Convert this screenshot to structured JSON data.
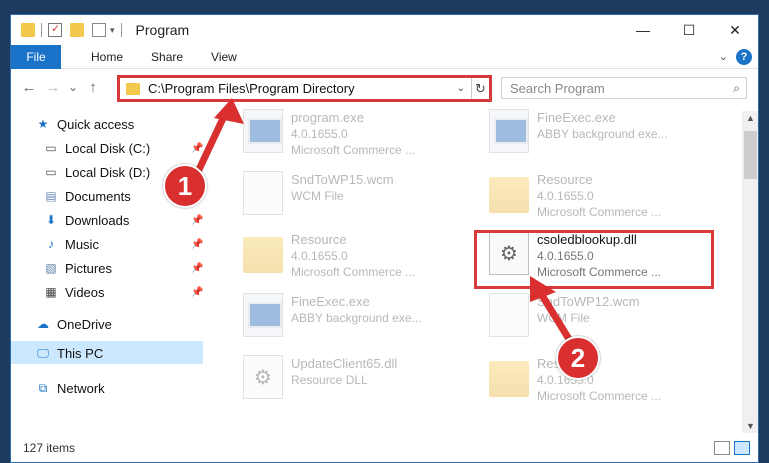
{
  "window": {
    "title": "Program",
    "controls": [
      "—",
      "☐",
      "✕"
    ]
  },
  "ribbon": {
    "file_tab": "File",
    "tabs": [
      "Home",
      "Share",
      "View"
    ],
    "help": "?"
  },
  "nav": {
    "back": "←",
    "forward": "→",
    "recent": "⌄",
    "up": "↑",
    "address": "C:\\Program Files\\Program Directory",
    "search_placeholder": "Search Program"
  },
  "sidebar": {
    "items": [
      {
        "label": "Quick access",
        "icon": "star-icon"
      },
      {
        "label": "Local Disk (C:)",
        "icon": "drive-icon"
      },
      {
        "label": "Local Disk (D:)",
        "icon": "drive-icon"
      },
      {
        "label": "Documents",
        "icon": "documents-icon"
      },
      {
        "label": "Downloads",
        "icon": "download-icon"
      },
      {
        "label": "Music",
        "icon": "music-icon"
      },
      {
        "label": "Pictures",
        "icon": "pictures-icon"
      },
      {
        "label": "Videos",
        "icon": "videos-icon"
      },
      {
        "label": "OneDrive",
        "icon": "cloud-icon"
      },
      {
        "label": "This PC",
        "icon": "computer-icon"
      },
      {
        "label": "Network",
        "icon": "network-icon"
      }
    ]
  },
  "files": [
    {
      "name": "program.exe",
      "line1": "4.0.1655.0",
      "line2": "Microsoft Commerce ...",
      "kind": "exe"
    },
    {
      "name": "FineExec.exe",
      "line1": "ABBY background exe...",
      "line2": "",
      "kind": "exe"
    },
    {
      "name": "SndToWP15.wcm",
      "line1": "WCM File",
      "line2": "",
      "kind": "doc"
    },
    {
      "name": "Resource",
      "line1": "4.0.1655.0",
      "line2": "Microsoft Commerce ...",
      "kind": "folder"
    },
    {
      "name": "Resource",
      "line1": "4.0.1655.0",
      "line2": "Microsoft Commerce ...",
      "kind": "folder"
    },
    {
      "name": "csoledblookup.dll",
      "line1": "4.0.1655.0",
      "line2": "Microsoft Commerce ...",
      "kind": "dll"
    },
    {
      "name": "FineExec.exe",
      "line1": "ABBY background exe...",
      "line2": "",
      "kind": "exe"
    },
    {
      "name": "SndToWP12.wcm",
      "line1": "WCM File",
      "line2": "",
      "kind": "doc"
    },
    {
      "name": "UpdateClient65.dll",
      "line1": "Resource DLL",
      "line2": "",
      "kind": "dll"
    },
    {
      "name": "Resource",
      "line1": "4.0.1655.0",
      "line2": "Microsoft Commerce ...",
      "kind": "folder"
    }
  ],
  "status": {
    "count": "127 items"
  },
  "callouts": [
    "1",
    "2"
  ],
  "colors": {
    "accent": "#1a73c8",
    "highlight": "#d63a3a",
    "selection": "#cce8ff"
  }
}
